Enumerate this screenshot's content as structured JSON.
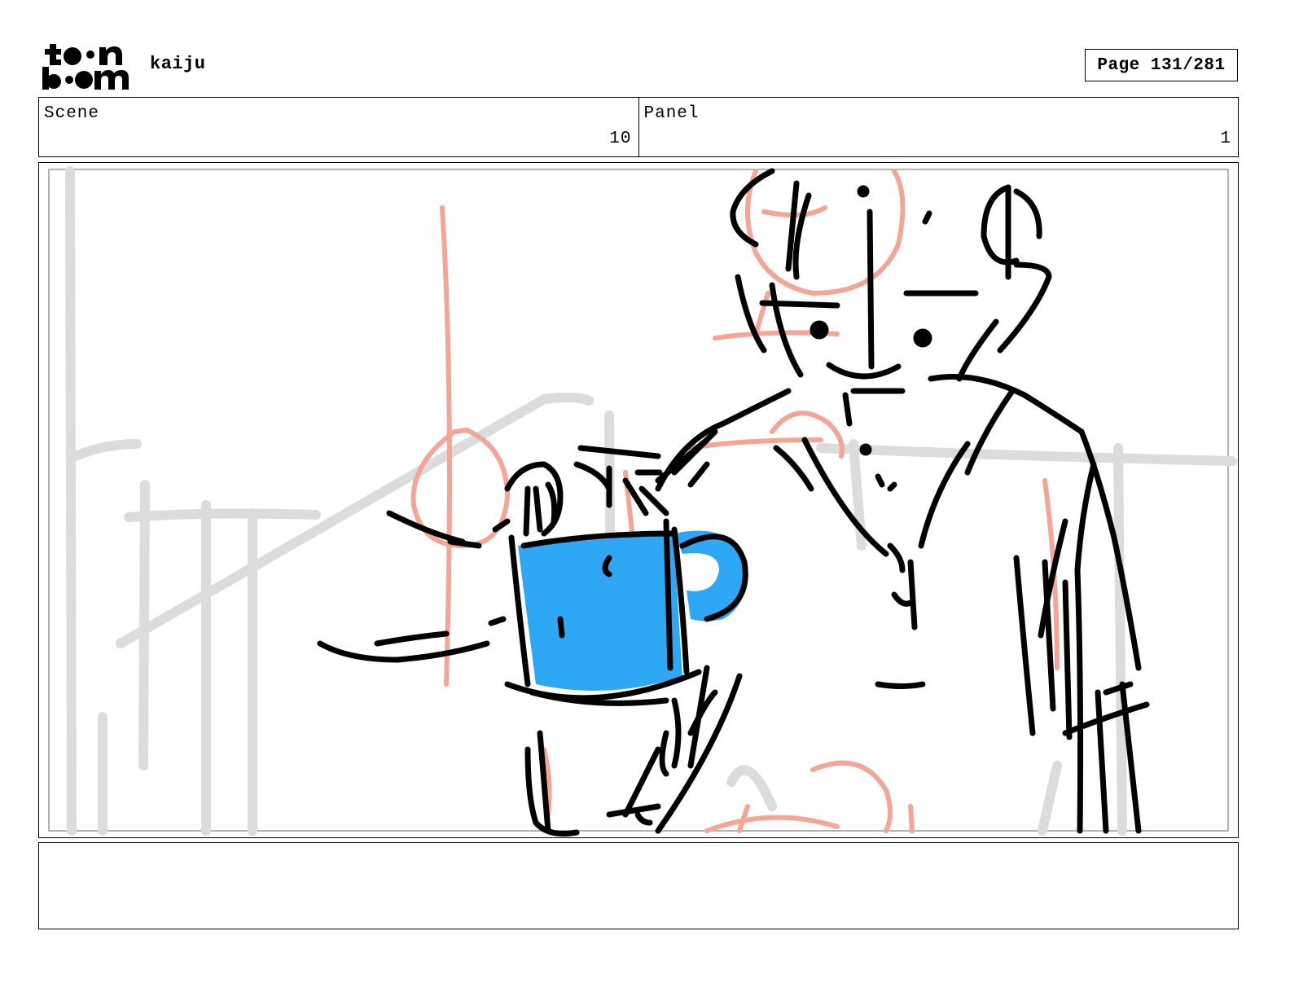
{
  "header": {
    "logo_top": "toon",
    "logo_bottom": "boom",
    "project_title": "kaiju",
    "page_label": "Page 131/281"
  },
  "info": {
    "scene_label": "Scene",
    "scene_value": "10",
    "panel_label": "Panel",
    "panel_value": "1"
  },
  "panel": {
    "colors": {
      "ink": "#000000",
      "rough_sketch": "#f4a595",
      "background_sketch": "#d9d9d9",
      "mug_fill": "#2ea7f5"
    }
  },
  "notes": {
    "text": ""
  }
}
